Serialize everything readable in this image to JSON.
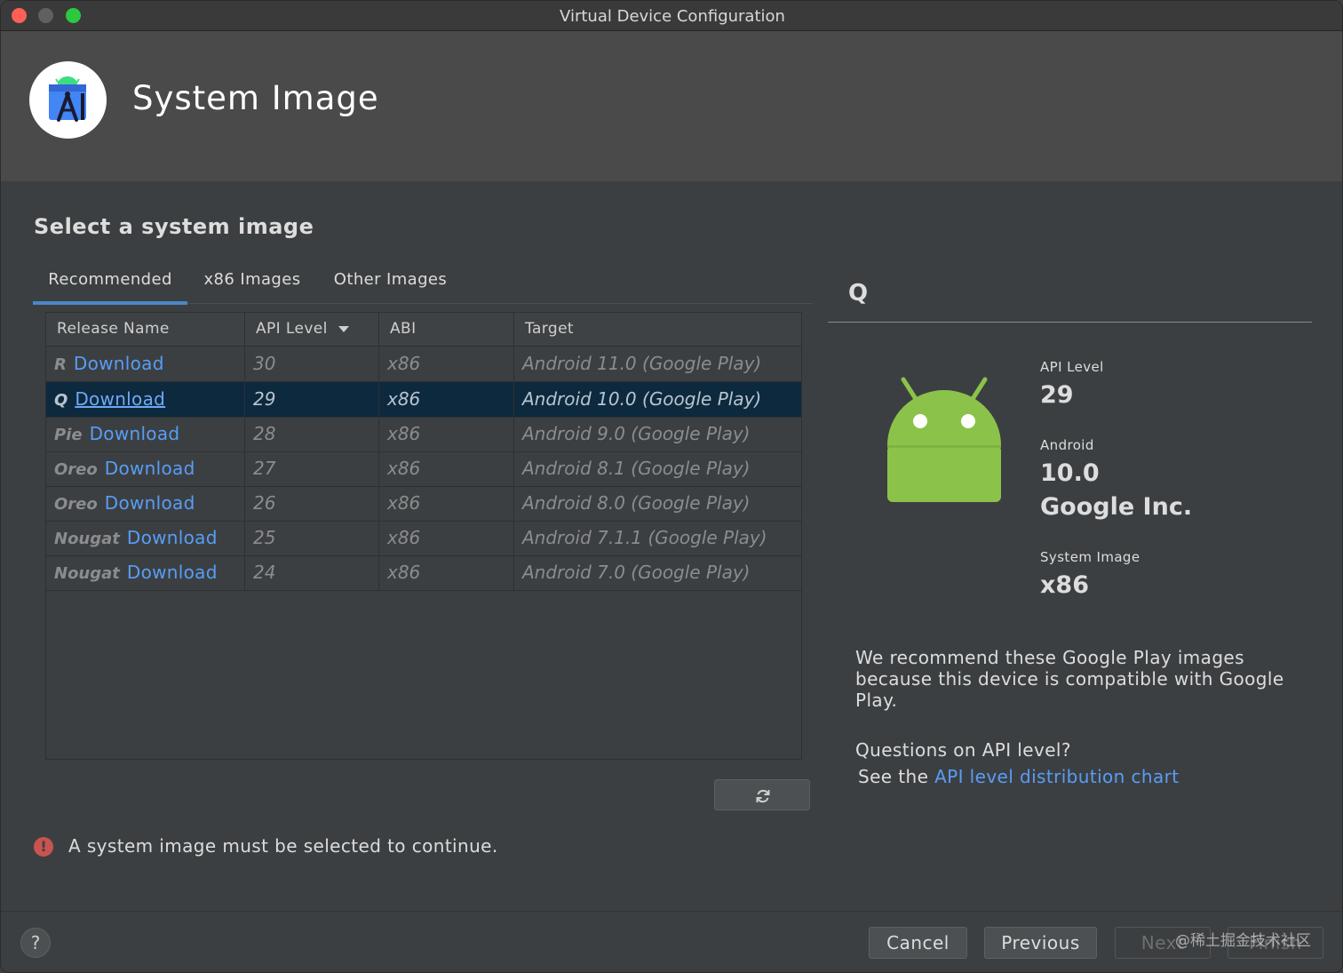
{
  "window": {
    "title": "Virtual Device Configuration"
  },
  "header": {
    "title": "System Image"
  },
  "section": {
    "title": "Select a system image"
  },
  "tabs": [
    {
      "label": "Recommended",
      "active": true
    },
    {
      "label": "x86 Images",
      "active": false
    },
    {
      "label": "Other Images",
      "active": false
    }
  ],
  "table": {
    "columns": [
      "Release Name",
      "API Level",
      "ABI",
      "Target"
    ],
    "rows": [
      {
        "release": "R",
        "action": "Download",
        "api": "30",
        "abi": "x86",
        "target": "Android 11.0 (Google Play)"
      },
      {
        "release": "Q",
        "action": "Download",
        "api": "29",
        "abi": "x86",
        "target": "Android 10.0 (Google Play)"
      },
      {
        "release": "Pie",
        "action": "Download",
        "api": "28",
        "abi": "x86",
        "target": "Android 9.0 (Google Play)"
      },
      {
        "release": "Oreo",
        "action": "Download",
        "api": "27",
        "abi": "x86",
        "target": "Android 8.1 (Google Play)"
      },
      {
        "release": "Oreo",
        "action": "Download",
        "api": "26",
        "abi": "x86",
        "target": "Android 8.0 (Google Play)"
      },
      {
        "release": "Nougat",
        "action": "Download",
        "api": "25",
        "abi": "x86",
        "target": "Android 7.1.1 (Google Play)"
      },
      {
        "release": "Nougat",
        "action": "Download",
        "api": "24",
        "abi": "x86",
        "target": "Android 7.0 (Google Play)"
      }
    ],
    "selected_index": 1
  },
  "error": {
    "message": "A system image must be selected to continue."
  },
  "details": {
    "title": "Q",
    "api_level_label": "API Level",
    "api_level_value": "29",
    "android_label": "Android",
    "android_value": "10.0",
    "vendor": "Google Inc.",
    "system_image_label": "System Image",
    "system_image_value": "x86",
    "recommend_text": "We recommend these Google Play images because this device is compatible with Google Play.",
    "questions_text": "Questions on API level?",
    "see_the_text": "See the",
    "chart_link": "API level distribution chart"
  },
  "footer": {
    "help": "?",
    "cancel": "Cancel",
    "previous": "Previous",
    "next": "Next",
    "finish": "Finish"
  },
  "watermark": "@稀土掘金技术社区",
  "colors": {
    "accent": "#4a88c7",
    "link": "#589df6",
    "selected_row": "#0d293e",
    "error": "#c75450",
    "android_green": "#8bc34a"
  }
}
